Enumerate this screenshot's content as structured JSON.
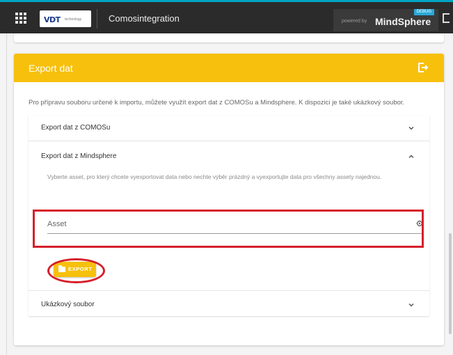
{
  "topbar": {
    "logo_text": "VDT",
    "logo_sub": "technology",
    "app_title": "Comosintegration",
    "tenant_tag": "DEBUG",
    "powered_by": "powered by",
    "brand": "MindSphere"
  },
  "icons": {
    "app_launcher": "grid-icon",
    "logout": "logout-icon",
    "export_header": "export-icon",
    "chevron_down": "chevron-down-icon",
    "chevron_up": "chevron-up-icon",
    "asset_picker": "gear-icon",
    "folder": "folder-icon"
  },
  "colors": {
    "accent": "#f7c00d",
    "topbar": "#2b2b2b",
    "highlight": "#d61f2a"
  },
  "card": {
    "title": "Export dat",
    "intro": "Pro přípravu souboru určené k importu, můžete využít export dat z COMOSu a Mindsphere. K dispozici je také ukázkový soubor."
  },
  "panels": [
    {
      "title": "Export dat z COMOSu",
      "expanded": false
    },
    {
      "title": "Export dat z Mindsphere",
      "expanded": true,
      "description": "Vyberte asset, pro který chcete vyexportovat data nebo nechte výběr prázdný a vyexportujte data pro všechny assety najednou.",
      "asset_placeholder": "Asset",
      "export_label": "EXPORT"
    },
    {
      "title": "Ukázkový soubor",
      "expanded": false
    }
  ]
}
